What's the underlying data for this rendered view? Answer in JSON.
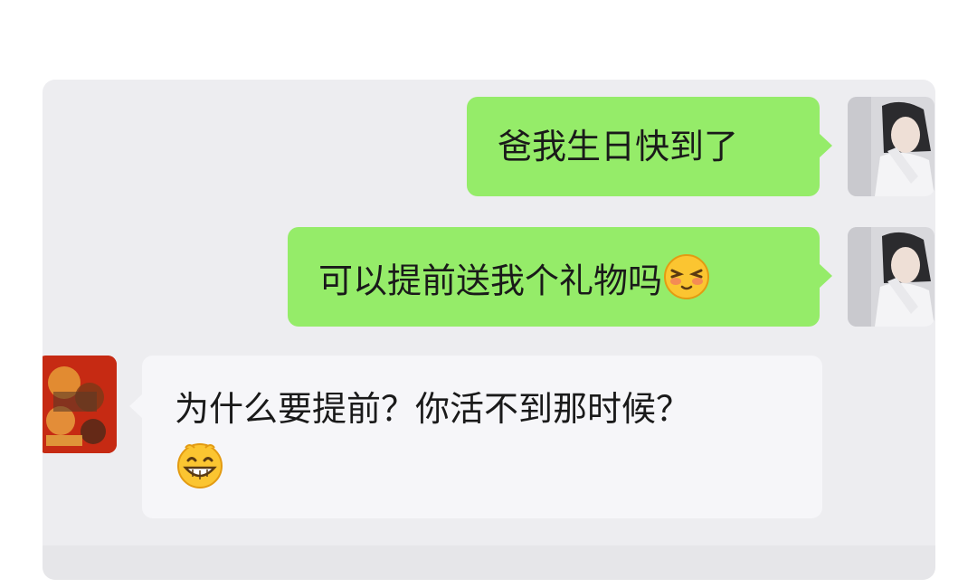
{
  "messages": [
    {
      "direction": "outgoing",
      "text": "爸我生日快到了"
    },
    {
      "direction": "outgoing",
      "text": "可以提前送我个礼物吗",
      "emoji": "shy-blushing-face"
    },
    {
      "direction": "incoming",
      "text": "为什么要提前？你活不到那时候？",
      "emoji": "grinning-face"
    }
  ],
  "colors": {
    "outgoing_bubble": "#95ec69",
    "incoming_bubble": "#f6f6f9",
    "chat_background": "#ededf0"
  }
}
